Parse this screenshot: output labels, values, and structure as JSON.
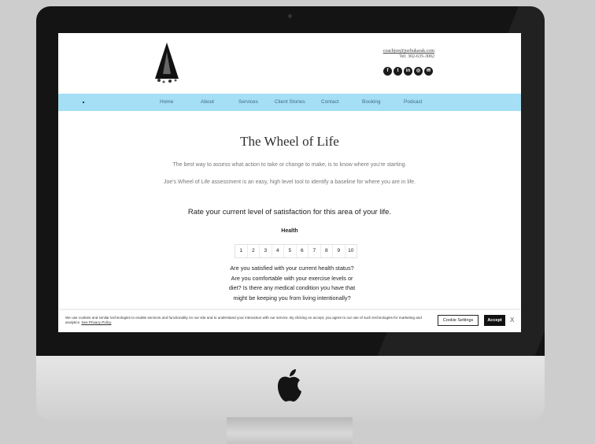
{
  "header": {
    "email": "coachjoe@joebukarak.com",
    "phone": "Tel: 302-635-3002",
    "social_icons": [
      "facebook-icon",
      "twitter-icon",
      "linkedin-icon",
      "instagram-icon",
      "email-icon"
    ]
  },
  "nav": {
    "items": [
      "Home",
      "About",
      "Services",
      "Client Stories",
      "Contact",
      "Booking",
      "Podcast"
    ]
  },
  "main": {
    "title": "The Wheel of Life",
    "intro1": "The best way to assess what action to take or change to make, is to know where you're starting.",
    "intro2": "Joe's Wheel of Life assessment is an easy, high level tool to identify a baseline for where you are in life.",
    "rate_prompt": "Rate your current level of satisfaction for this area of your life.",
    "category": "Health",
    "scale": [
      "1",
      "2",
      "3",
      "4",
      "5",
      "6",
      "7",
      "8",
      "9",
      "10"
    ],
    "question": "Are you satisfied with your current health status? Are you comfortable with your exercise levels or diet? Is there any medical condition you have that might be keeping you from living intentionally?"
  },
  "cookie": {
    "text": "We use cookies and similar technologies to enable services and functionality on our site and to understand your interaction with our service. By clicking on accept, you agree to our use of such technologies for marketing and analytics.",
    "policy_link": "See Privacy Policy",
    "settings_label": "Cookie Settings",
    "accept_label": "Accept",
    "close_label": "X"
  },
  "colors": {
    "nav_bg": "#a4dff5",
    "nav_text": "#466b84",
    "accept_bg": "#111111"
  }
}
